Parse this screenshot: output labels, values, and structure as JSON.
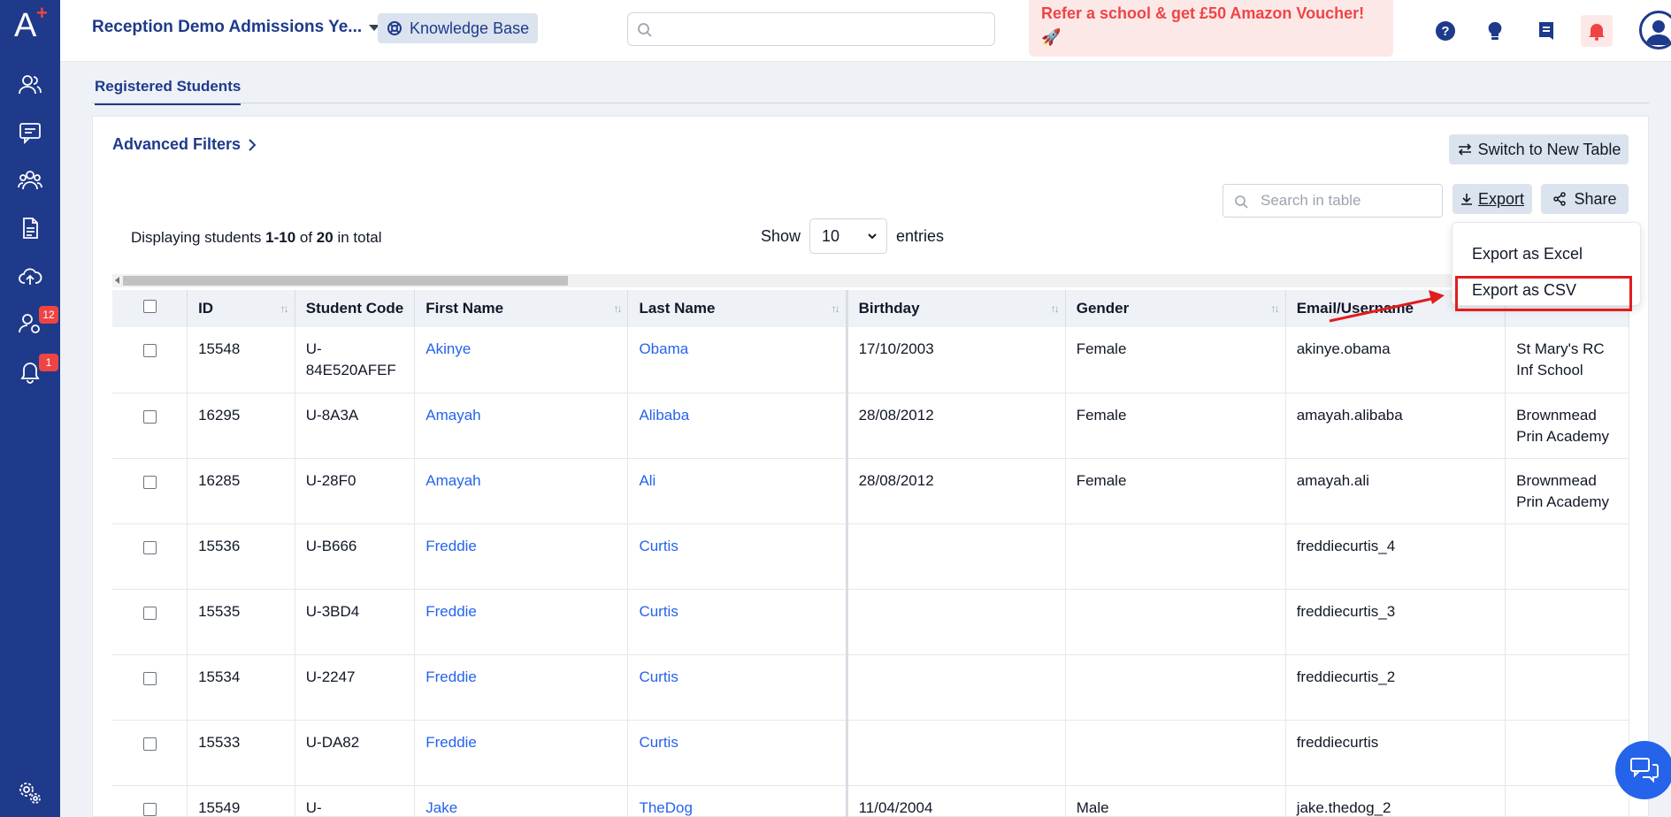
{
  "app": {
    "logo_text": "A",
    "school_name": "Reception Demo Admissions Ye...",
    "knowledge_base_label": "Knowledge Base",
    "promo_text": "Refer a school & get £50 Amazon Voucher!",
    "promo_emoji": "🚀"
  },
  "sidebar": {
    "items": [
      {
        "icon": "users-icon"
      },
      {
        "icon": "message-icon"
      },
      {
        "icon": "group-icon"
      },
      {
        "icon": "document-icon"
      },
      {
        "icon": "cloud-upload-icon"
      },
      {
        "icon": "user-settings-icon",
        "badge": "12"
      },
      {
        "icon": "bell-icon",
        "badge": "1"
      },
      {
        "icon": "settings-icon"
      }
    ]
  },
  "page": {
    "tab_label": "Registered Students",
    "advanced_filters_label": "Advanced Filters",
    "switch_table_label": "Switch to New Table",
    "table_search_placeholder": "Search in table",
    "export_label": "Export",
    "share_label": "Share",
    "display_prefix": "Displaying students ",
    "display_range": "1-10",
    "display_of": " of ",
    "display_total": "20",
    "display_suffix": " in total",
    "show_label": "Show",
    "entries_value": "10",
    "entries_label": "entries"
  },
  "export_menu": {
    "excel_label": "Export as Excel",
    "csv_label": "Export as CSV"
  },
  "table": {
    "columns": [
      "ID",
      "Student Code",
      "First Name",
      "Last Name",
      "Birthday",
      "Gender",
      "Email/Username",
      ""
    ],
    "rows": [
      {
        "id": "15548",
        "code": "U-84E520AFEF",
        "first": "Akinye",
        "last": "Obama",
        "birthday": "17/10/2003",
        "gender": "Female",
        "email": "akinye.obama",
        "school": "St Mary's RC Inf School"
      },
      {
        "id": "16295",
        "code": "U-8A3A",
        "first": "Amayah",
        "last": "Alibaba",
        "birthday": "28/08/2012",
        "gender": "Female",
        "email": "amayah.alibaba",
        "school": "Brownmead Prin Academy"
      },
      {
        "id": "16285",
        "code": "U-28F0",
        "first": "Amayah",
        "last": "Ali",
        "birthday": "28/08/2012",
        "gender": "Female",
        "email": "amayah.ali",
        "school": "Brownmead Prin Academy"
      },
      {
        "id": "15536",
        "code": "U-B666",
        "first": "Freddie",
        "last": "Curtis",
        "birthday": "",
        "gender": "",
        "email": "freddiecurtis_4",
        "school": ""
      },
      {
        "id": "15535",
        "code": "U-3BD4",
        "first": "Freddie",
        "last": "Curtis",
        "birthday": "",
        "gender": "",
        "email": "freddiecurtis_3",
        "school": ""
      },
      {
        "id": "15534",
        "code": "U-2247",
        "first": "Freddie",
        "last": "Curtis",
        "birthday": "",
        "gender": "",
        "email": "freddiecurtis_2",
        "school": ""
      },
      {
        "id": "15533",
        "code": "U-DA82",
        "first": "Freddie",
        "last": "Curtis",
        "birthday": "",
        "gender": "",
        "email": "freddiecurtis",
        "school": ""
      },
      {
        "id": "15549",
        "code": "U-",
        "first": "Jake",
        "last": "TheDog",
        "birthday": "11/04/2004",
        "gender": "Male",
        "email": "jake.thedog_2",
        "school": ""
      }
    ]
  },
  "colors": {
    "sidebar": "#1f3a8a",
    "accent": "#1e3a8a",
    "link": "#2563eb",
    "alert": "#ef4444"
  }
}
